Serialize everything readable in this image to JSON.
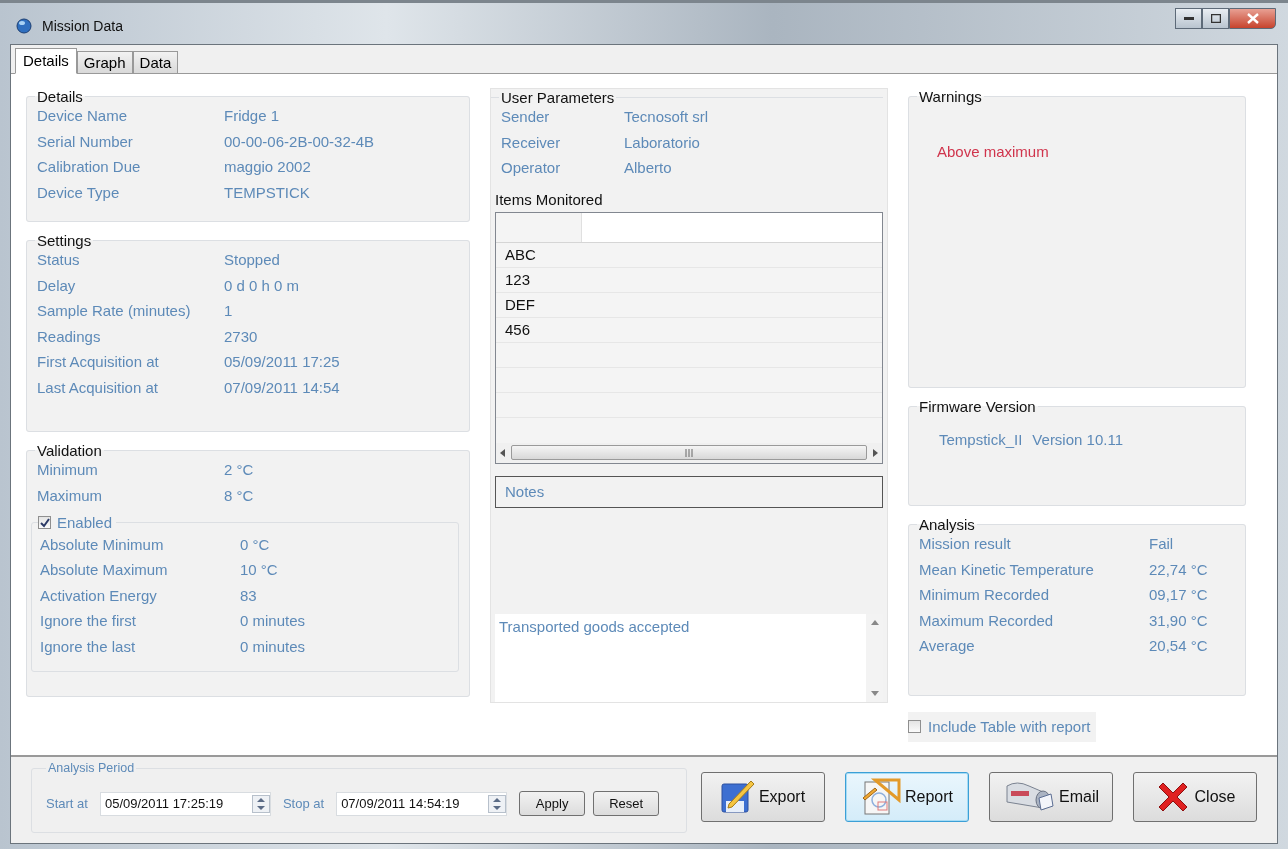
{
  "window": {
    "title": "Mission Data"
  },
  "tabs": [
    {
      "label": "Details",
      "selected": true
    },
    {
      "label": "Graph",
      "selected": false
    },
    {
      "label": "Data",
      "selected": false
    }
  ],
  "details": {
    "title": "Details",
    "rows": [
      {
        "label": "Device Name",
        "value": "Fridge 1"
      },
      {
        "label": "Serial Number",
        "value": "00-00-06-2B-00-32-4B"
      },
      {
        "label": "Calibration Due",
        "value": "maggio 2002"
      },
      {
        "label": "Device Type",
        "value": "TEMPSTICK"
      }
    ]
  },
  "settings": {
    "title": "Settings",
    "rows": [
      {
        "label": "Status",
        "value": "Stopped"
      },
      {
        "label": "Delay",
        "value": "0 d 0 h 0 m"
      },
      {
        "label": "Sample Rate (minutes)",
        "value": "1"
      },
      {
        "label": "Readings",
        "value": "2730"
      },
      {
        "label": "First Acquisition at",
        "value": "05/09/2011 17:25"
      },
      {
        "label": "Last Acquisition at",
        "value": "07/09/2011 14:54"
      }
    ]
  },
  "validation": {
    "title": "Validation",
    "rows": [
      {
        "label": "Minimum",
        "value": "2 °C"
      },
      {
        "label": "Maximum",
        "value": "8 °C"
      }
    ],
    "enabled": {
      "label": "Enabled",
      "checked": true
    },
    "sub_rows": [
      {
        "label": "Absolute Minimum",
        "value": "0 °C"
      },
      {
        "label": "Absolute Maximum",
        "value": "10 °C"
      },
      {
        "label": "Activation Energy",
        "value": "83"
      },
      {
        "label": "Ignore the first",
        "value": "0 minutes"
      },
      {
        "label": "Ignore the last",
        "value": "0 minutes"
      }
    ]
  },
  "user_parameters": {
    "title": "User Parameters",
    "rows": [
      {
        "label": "Sender",
        "value": "Tecnosoft srl"
      },
      {
        "label": "Receiver",
        "value": "Laboratorio"
      },
      {
        "label": "Operator",
        "value": "Alberto"
      }
    ]
  },
  "items_monitored": {
    "title": "Items Monitored",
    "rows": [
      "ABC",
      "123",
      "DEF",
      "456"
    ]
  },
  "notes": {
    "title": "Notes",
    "text": "Transported goods accepted"
  },
  "warnings": {
    "title": "Warnings",
    "items": [
      "Above maximum"
    ]
  },
  "firmware": {
    "title": "Firmware Version",
    "name": "Tempstick_II",
    "version": "Version 10.11"
  },
  "analysis": {
    "title": "Analysis",
    "rows": [
      {
        "label": "Mission result",
        "value": "Fail"
      },
      {
        "label": "Mean Kinetic Temperature",
        "value": "22,74 °C"
      },
      {
        "label": "Minimum Recorded",
        "value": "09,17 °C"
      },
      {
        "label": "Maximum Recorded",
        "value": "31,90 °C"
      },
      {
        "label": "Average",
        "value": "20,54 °C"
      }
    ]
  },
  "include_table": {
    "label": "Include Table with report",
    "checked": false
  },
  "analysis_period": {
    "title": "Analysis Period",
    "start": {
      "label": "Start at",
      "value": "05/09/2011 17:25:19"
    },
    "stop": {
      "label": "Stop at",
      "value": "07/09/2011 14:54:19"
    },
    "buttons": [
      "Apply",
      "Reset"
    ]
  },
  "actions": [
    {
      "label": "Export",
      "kind": "export",
      "focused": false
    },
    {
      "label": "Report",
      "kind": "report",
      "focused": true
    },
    {
      "label": "Email",
      "kind": "email",
      "focused": false
    },
    {
      "label": "Close",
      "kind": "close",
      "focused": false
    }
  ]
}
